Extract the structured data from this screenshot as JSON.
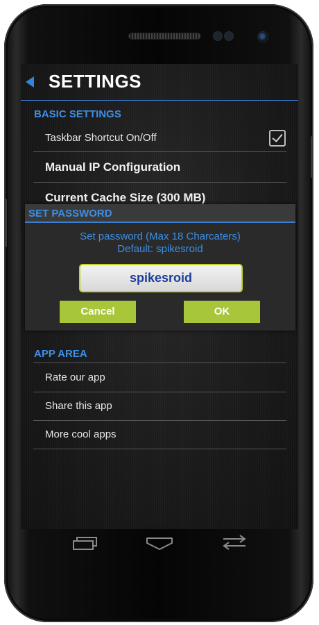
{
  "header": {
    "title": "SETTINGS"
  },
  "basic_settings": {
    "header": "BASIC SETTINGS",
    "items": [
      {
        "label": "Taskbar Shortcut On/Off",
        "checked": true
      },
      {
        "label": "Manual IP Configuration"
      },
      {
        "label": "Current Cache Size (300 MB)"
      }
    ]
  },
  "dialog": {
    "title": "SET PASSWORD",
    "message_line1": "Set password (Max 18 Charcaters)",
    "message_line2": "Default: spikesroid",
    "input_value": "spikesroid",
    "cancel_label": "Cancel",
    "ok_label": "OK"
  },
  "app_area": {
    "header": "APP AREA",
    "items": [
      {
        "label": "Rate our app"
      },
      {
        "label": "Share this app"
      },
      {
        "label": "More cool apps"
      }
    ]
  },
  "navigation": {
    "recent_icon": "recent-apps-icon",
    "home_icon": "home-icon",
    "back_icon": "back-icon"
  },
  "colors": {
    "accent": "#3d8fe6",
    "button": "#a8c63a",
    "input_text": "#1d3d9a",
    "background": "#1a1a1a"
  }
}
